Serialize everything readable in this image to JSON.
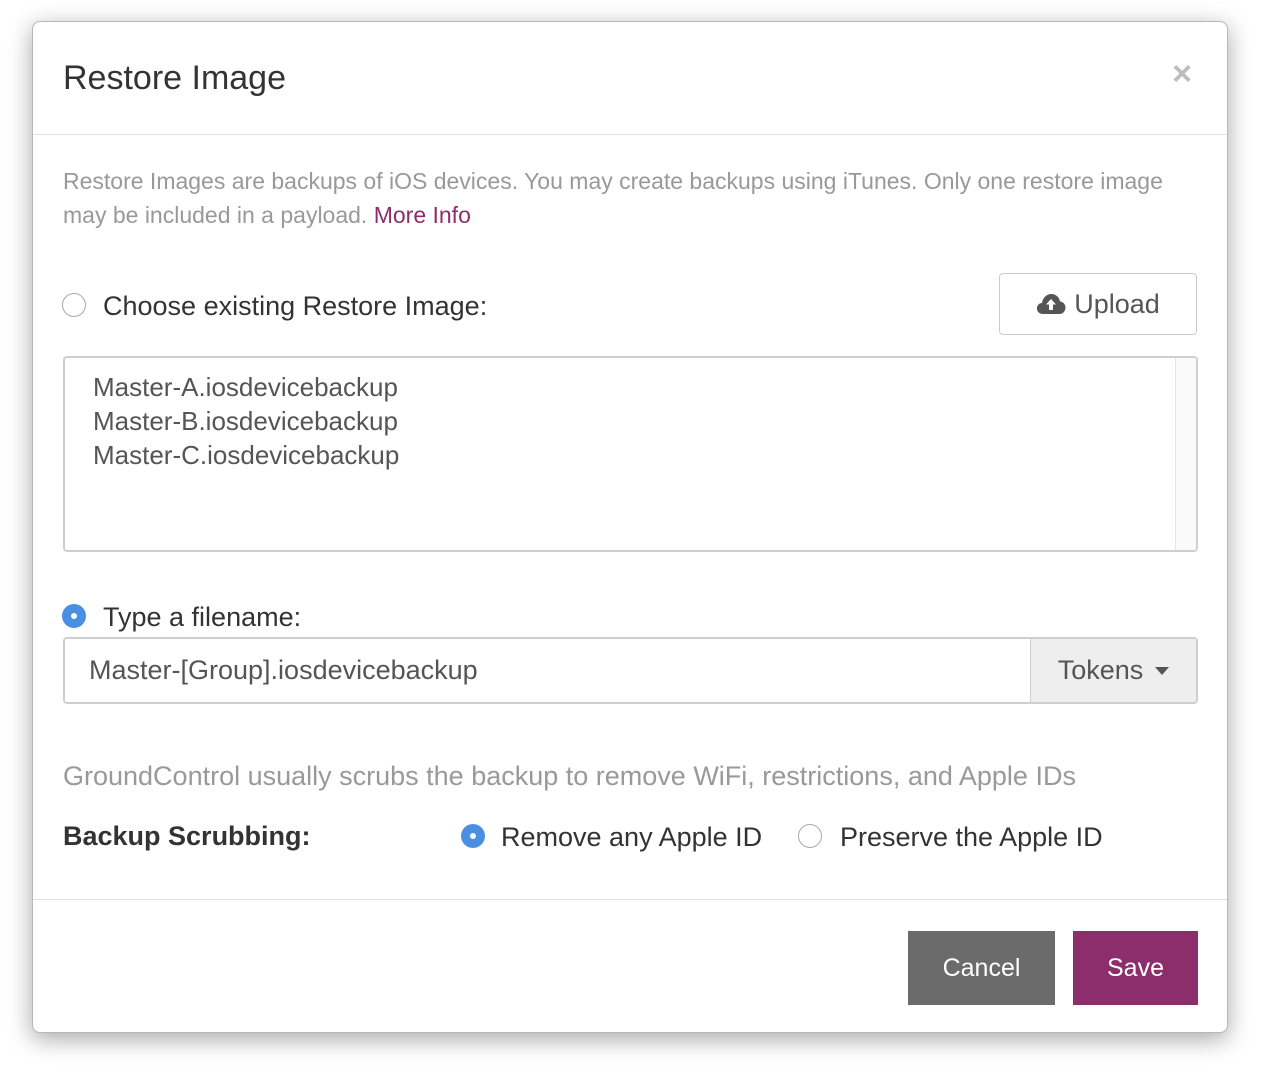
{
  "modal": {
    "title": "Restore Image",
    "close_glyph": "×",
    "intro_text": "Restore Images are backups of iOS devices. You may create backups using iTunes. Only one restore image may be included in a payload. ",
    "more_info_link": "More Info"
  },
  "existing": {
    "label": "Choose existing Restore Image:",
    "selected": false,
    "upload_label": "Upload",
    "upload_icon": "cloud-upload-icon",
    "files": [
      "Master-A.iosdevicebackup",
      "Master-B.iosdevicebackup",
      "Master-C.iosdevicebackup"
    ]
  },
  "filename": {
    "label": "Type a filename:",
    "selected": true,
    "value": "Master-[Group].iosdevicebackup",
    "tokens_label": "Tokens"
  },
  "scrubbing": {
    "info": "GroundControl usually scrubs the backup to remove WiFi, restrictions, and Apple IDs",
    "label": "Backup Scrubbing:",
    "options": [
      {
        "label": "Remove any Apple ID",
        "selected": true
      },
      {
        "label": "Preserve the Apple ID",
        "selected": false
      }
    ]
  },
  "footer": {
    "cancel_label": "Cancel",
    "save_label": "Save"
  },
  "colors": {
    "accent": "#8c2e6b",
    "radio_selected": "#4a90e2",
    "cancel_bg": "#6b6b6b"
  }
}
